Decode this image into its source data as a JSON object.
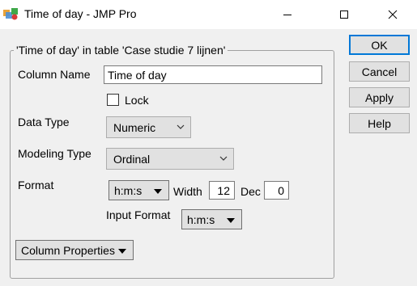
{
  "window": {
    "title": "Time of day - JMP Pro",
    "app_icon": "jmp-app-icon",
    "controls": {
      "minimize": "minimize-icon",
      "maximize": "maximize-icon",
      "close": "close-icon"
    }
  },
  "group": {
    "title": "'Time of day' in table 'Case studie 7 lijnen'"
  },
  "form": {
    "column_name_label": "Column Name",
    "column_name_value": "Time of day",
    "lock_label": "Lock",
    "lock_checked": false,
    "data_type_label": "Data Type",
    "data_type_value": "Numeric",
    "modeling_type_label": "Modeling Type",
    "modeling_type_value": "Ordinal",
    "format_label": "Format",
    "format_value": "h:m:s",
    "width_label": "Width",
    "width_value": "12",
    "dec_label": "Dec",
    "dec_value": "0",
    "input_format_label": "Input Format",
    "input_format_value": "h:m:s",
    "column_properties_label": "Column Properties"
  },
  "buttons": {
    "ok": "OK",
    "cancel": "Cancel",
    "apply": "Apply",
    "help": "Help"
  },
  "colors": {
    "accent": "#0078d7",
    "titlebar": "#ffffff",
    "dialog_bg": "#f0f0f0"
  }
}
